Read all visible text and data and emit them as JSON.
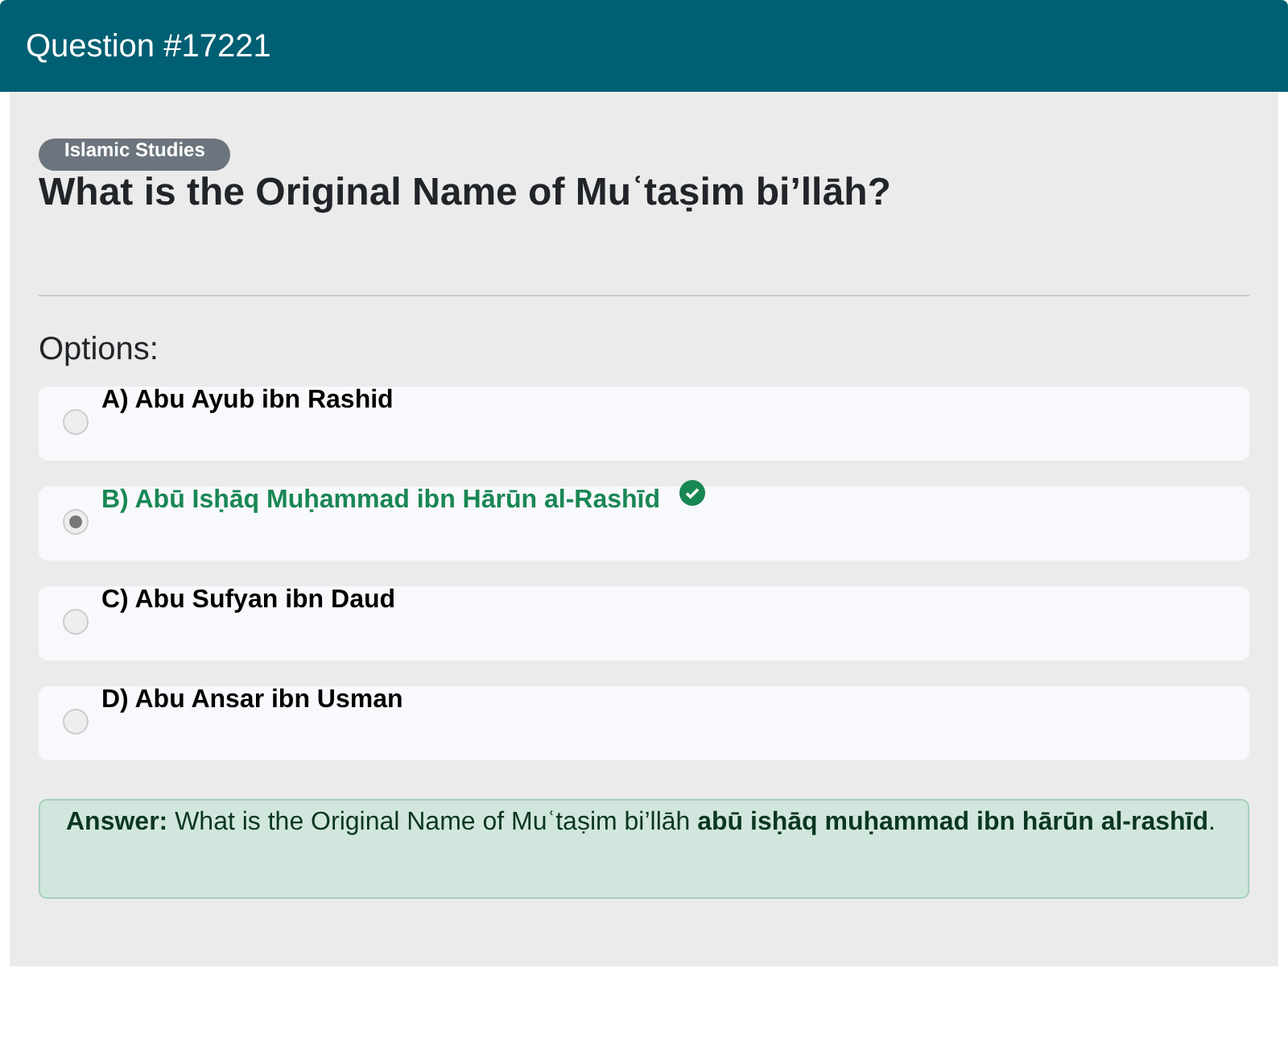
{
  "header": {
    "title": "Question #17221"
  },
  "category": "Islamic Studies",
  "question": "What is the Original Name of Muʿtaṣim bi’llāh?",
  "options_label": "Options:",
  "options": [
    {
      "label": "A) Abu Ayub ibn Rashid",
      "selected": false,
      "correct": false
    },
    {
      "label": "B)  Abū Isḥāq Muḥammad ibn Hārūn al-Rashīd",
      "selected": true,
      "correct": true
    },
    {
      "label": "C) Abu Sufyan ibn Daud",
      "selected": false,
      "correct": false
    },
    {
      "label": "D) Abu Ansar ibn Usman",
      "selected": false,
      "correct": false
    }
  ],
  "answer": "**Answer:** What is the Original Name of Muʿtaṣim bi’llāh  **abū isḥāq muḥammad ibn hārūn al-rashīd**."
}
